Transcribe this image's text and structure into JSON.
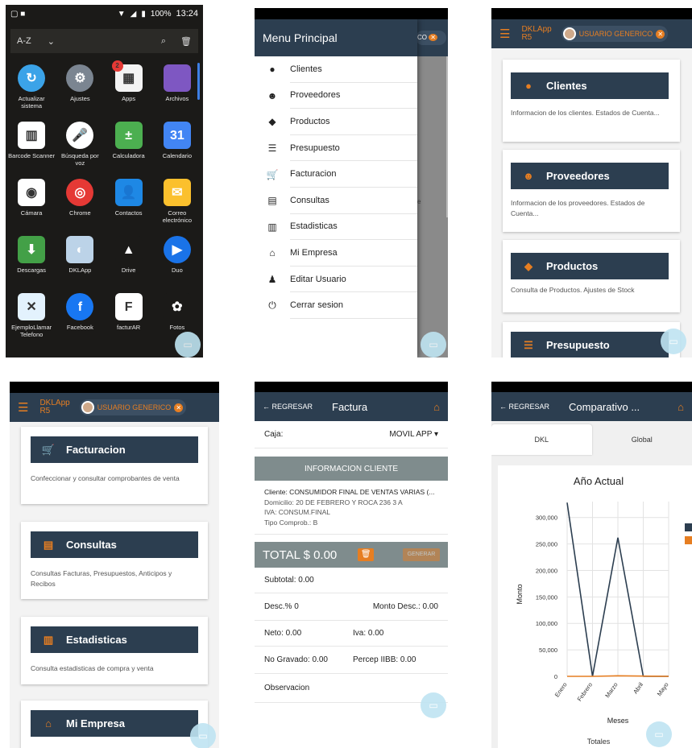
{
  "p1": {
    "status": {
      "battery": "100%",
      "time": "13:24"
    },
    "sort_label": "A-Z",
    "apps": [
      {
        "label": "Actualizar sistema",
        "icon": "refresh-icon",
        "color": "#3ba3e8",
        "glyph": "↻",
        "round": true
      },
      {
        "label": "Ajustes",
        "icon": "gear-icon",
        "color": "#7b8591",
        "glyph": "⚙",
        "round": true
      },
      {
        "label": "Apps",
        "icon": "apps-store-icon",
        "color": "#f3f3f3",
        "glyph": "▦",
        "round": false,
        "badge": "2"
      },
      {
        "label": "Archivos",
        "icon": "folder-icon",
        "color": "#7e57c2",
        "glyph": "",
        "round": false
      },
      {
        "label": "Barcode Scanner",
        "icon": "barcode-icon",
        "color": "#ffffff",
        "glyph": "▥",
        "round": false
      },
      {
        "label": "Búsqueda por voz",
        "icon": "mic-icon",
        "color": "#ffffff",
        "glyph": "🎤",
        "round": true
      },
      {
        "label": "Calculadora",
        "icon": "calculator-icon",
        "color": "#4caf50",
        "glyph": "±",
        "round": false
      },
      {
        "label": "Calendario",
        "icon": "calendar-icon",
        "color": "#4285f4",
        "glyph": "31",
        "round": false
      },
      {
        "label": "Cámara",
        "icon": "camera-icon",
        "color": "#ffffff",
        "glyph": "◉",
        "round": false
      },
      {
        "label": "Chrome",
        "icon": "chrome-icon",
        "color": "#e53935",
        "glyph": "◎",
        "round": true
      },
      {
        "label": "Contactos",
        "icon": "contacts-icon",
        "color": "#1e88e5",
        "glyph": "👤",
        "round": false
      },
      {
        "label": "Correo electrónico",
        "icon": "mail-icon",
        "color": "#fbc02d",
        "glyph": "✉",
        "round": false
      },
      {
        "label": "Descargas",
        "icon": "download-icon",
        "color": "#43a047",
        "glyph": "⬇",
        "round": false
      },
      {
        "label": "DKLApp",
        "icon": "dklapp-icon",
        "color": "#bcd3e8",
        "glyph": "◐",
        "round": false
      },
      {
        "label": "Drive",
        "icon": "drive-icon",
        "color": "#1b1a18",
        "glyph": "▲",
        "round": false
      },
      {
        "label": "Duo",
        "icon": "duo-icon",
        "color": "#1a73e8",
        "glyph": "▶",
        "round": true
      },
      {
        "label": "EjemploLlamar Telefono",
        "icon": "phone-app-icon",
        "color": "#e3f2fd",
        "glyph": "✕",
        "round": false
      },
      {
        "label": "Facebook",
        "icon": "facebook-icon",
        "color": "#1877f2",
        "glyph": "f",
        "round": true
      },
      {
        "label": "facturAR",
        "icon": "facturar-icon",
        "color": "#ffffff",
        "glyph": "F",
        "round": false
      },
      {
        "label": "Fotos",
        "icon": "photos-icon",
        "color": "#1b1a18",
        "glyph": "✿",
        "round": false
      }
    ]
  },
  "p2": {
    "title": "Menu Principal",
    "chip_text": "CO",
    "items": [
      {
        "label": "Clientes",
        "icon": "user-circle-icon",
        "glyph": "●"
      },
      {
        "label": "Proveedores",
        "icon": "supplier-icon",
        "glyph": "☻"
      },
      {
        "label": "Productos",
        "icon": "tag-icon",
        "glyph": "◆"
      },
      {
        "label": "Presupuesto",
        "icon": "list-icon",
        "glyph": "☰"
      },
      {
        "label": "Facturacion",
        "icon": "cart-icon",
        "glyph": "🛒"
      },
      {
        "label": "Consultas",
        "icon": "file-icon",
        "glyph": "▤"
      },
      {
        "label": "Estadisticas",
        "icon": "bar-chart-icon",
        "glyph": "▥"
      },
      {
        "label": "Mi Empresa",
        "icon": "home-icon",
        "glyph": "⌂"
      },
      {
        "label": "Editar Usuario",
        "icon": "user-icon",
        "glyph": "♟"
      },
      {
        "label": "Cerrar sesion",
        "icon": "power-icon",
        "glyph": "⏻"
      }
    ],
    "peek_text": "e"
  },
  "app": {
    "brand_line1": "DKLApp",
    "brand_line2": "R5",
    "user": "USUARIO GENERICO",
    "close_glyph": "✕"
  },
  "p3": {
    "cards": [
      {
        "title": "Clientes",
        "icon": "user-circle-icon",
        "glyph": "●",
        "desc": "Informacion de los clientes. Estados de Cuenta..."
      },
      {
        "title": "Proveedores",
        "icon": "supplier-icon",
        "glyph": "☻",
        "desc": "Informacion de los proveedores. Estados de Cuenta..."
      },
      {
        "title": "Productos",
        "icon": "tag-icon",
        "glyph": "◆",
        "desc": "Consulta de Productos. Ajustes de Stock"
      },
      {
        "title": "Presupuesto",
        "icon": "list-icon",
        "glyph": "☰",
        "desc": ""
      }
    ]
  },
  "p4": {
    "cards": [
      {
        "title": "Facturacion",
        "icon": "cart-icon",
        "glyph": "🛒",
        "desc": "Confeccionar y consultar comprobantes de venta"
      },
      {
        "title": "Consultas",
        "icon": "file-icon",
        "glyph": "▤",
        "desc": "Consultas Facturas, Presupuestos, Anticipos y Recibos"
      },
      {
        "title": "Estadisticas",
        "icon": "bar-chart-icon",
        "glyph": "▥",
        "desc": "Consulta estadisticas de compra y venta"
      },
      {
        "title": "Mi Empresa",
        "icon": "home-icon",
        "glyph": "⌂",
        "desc": ""
      }
    ]
  },
  "p5": {
    "back": "← REGRESAR",
    "title": "Factura",
    "caja_label": "Caja:",
    "caja_value": "MOVIL APP ▾",
    "info_head": "INFORMACION CLIENTE",
    "cliente": "Cliente: CONSUMIDOR FINAL DE VENTAS VARIAS (...",
    "domicilio": "Domicilio: 20 DE FEBRERO Y ROCA 236 3 A",
    "iva_cond": "IVA: CONSUM.FINAL",
    "tipo": "Tipo Comprob.: B",
    "total": "TOTAL $ 0.00",
    "generar": "GENERAR",
    "subtotal": "Subtotal: 0.00",
    "desc_pct": "Desc.% 0",
    "monto_desc": "Monto Desc.: 0.00",
    "neto": "Neto: 0.00",
    "iva": "Iva: 0.00",
    "no_gravado": "No Gravado: 0.00",
    "percep": "Percep IIBB: 0.00",
    "observacion": "Observacion"
  },
  "p6": {
    "back": "← REGRESAR",
    "title": "Comparativo ...",
    "tabs": [
      "DKL",
      "Global"
    ],
    "footer": "Totales"
  },
  "chart_data": {
    "type": "line",
    "title": "Año Actual",
    "xlabel": "Meses",
    "ylabel": "Monto",
    "categories": [
      "Enero",
      "Febrero",
      "Marzo",
      "Abril",
      "Mayo"
    ],
    "ylim": [
      0,
      330000
    ],
    "yticks": [
      0,
      50000,
      100000,
      150000,
      200000,
      250000,
      300000
    ],
    "ytick_labels": [
      "0",
      "50,000",
      "100,000",
      "150,000",
      "200,000",
      "250,000",
      "300,000"
    ],
    "series": [
      {
        "color": "#2c3e50",
        "values": [
          328000,
          0,
          262000,
          0,
          0
        ]
      },
      {
        "color": "#e67e22",
        "values": [
          0,
          0,
          1000,
          500,
          0
        ]
      }
    ],
    "grid": true,
    "legend": "right"
  }
}
